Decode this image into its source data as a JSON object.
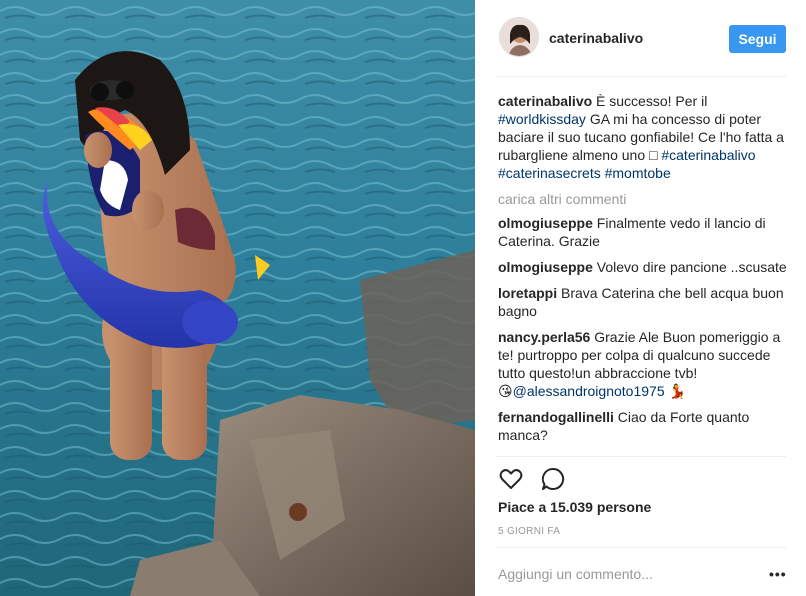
{
  "post": {
    "username": "caterinabalivo",
    "follow_label": "Segui",
    "caption": {
      "user": "caterinabalivo",
      "text_a": " È successo! Per il ",
      "tag_1": "#worldkissday",
      "text_b": " GA mi ha concesso di poter baciare il suo tucano gonfiabile! Ce l'ho fatta a rubargliene almeno uno ",
      "emoji": "□",
      "tag_2": "#caterinabalivo",
      "tag_3": "#caterinasecrets",
      "tag_4": "#momtobe"
    },
    "load_more": "carica altri commenti",
    "comments": [
      {
        "user": "olmogiuseppe",
        "text": " Finalmente vedo il lancio di Caterina. Grazie"
      },
      {
        "user": "olmogiuseppe",
        "text": " Volevo dire pancione ..scusate"
      },
      {
        "user": "loretappi",
        "text": " Brava Caterina che bell acqua buon bagno"
      },
      {
        "user": "nancy.perla56",
        "text": " Grazie Ale Buon pomeriggio a te! purtroppo per colpa di qualcuno succede tutto questo!un abbraccione tvb!",
        "emoji_a": "😘",
        "mention": "@alessandroignoto1975",
        "emoji_b": "💃"
      },
      {
        "user": "fernandogallinelli",
        "text": " Ciao da Forte quanto manca?"
      }
    ],
    "likes": "Piace a 15.039 persone",
    "time": "5 GIORNI FA",
    "add_comment_placeholder": "Aggiungi un commento...",
    "more_options": "•••",
    "icons": {
      "like": "heart-icon",
      "comment": "comment-bubble-icon",
      "options": "more-options-icon"
    }
  }
}
